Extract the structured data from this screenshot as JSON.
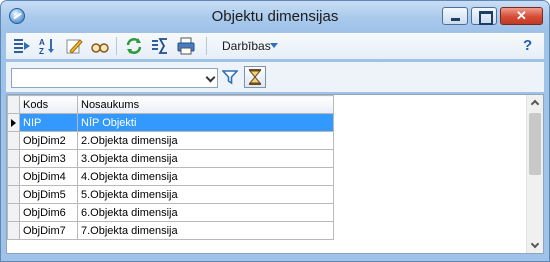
{
  "window": {
    "title": "Objektu dimensijas",
    "close_label": "✕"
  },
  "toolbar": {
    "icons": [
      "add-record-icon",
      "sort-icon",
      "edit-icon",
      "view-icon",
      "refresh-icon",
      "sum-icon",
      "print-icon"
    ],
    "darbibas_label": "Darbības",
    "help_label": "?"
  },
  "filter": {
    "combo_value": ""
  },
  "table": {
    "columns": [
      "Kods",
      "Nosaukums"
    ],
    "rows": [
      {
        "kods": "NIP",
        "nosaukums": "NĪP Objekti",
        "selected": true
      },
      {
        "kods": "ObjDim2",
        "nosaukums": "2.Objekta dimensija"
      },
      {
        "kods": "ObjDim3",
        "nosaukums": "3.Objekta dimensija"
      },
      {
        "kods": "ObjDim4",
        "nosaukums": "4.Objekta dimensija"
      },
      {
        "kods": "ObjDim5",
        "nosaukums": "5.Objekta dimensija"
      },
      {
        "kods": "ObjDim6",
        "nosaukums": "6.Objekta dimensija"
      },
      {
        "kods": "ObjDim7",
        "nosaukums": "7.Objekta dimensija"
      }
    ]
  },
  "colors": {
    "selection": "#3399ff",
    "window_frame": "#9fc3e8",
    "close_button": "#d54c36"
  }
}
